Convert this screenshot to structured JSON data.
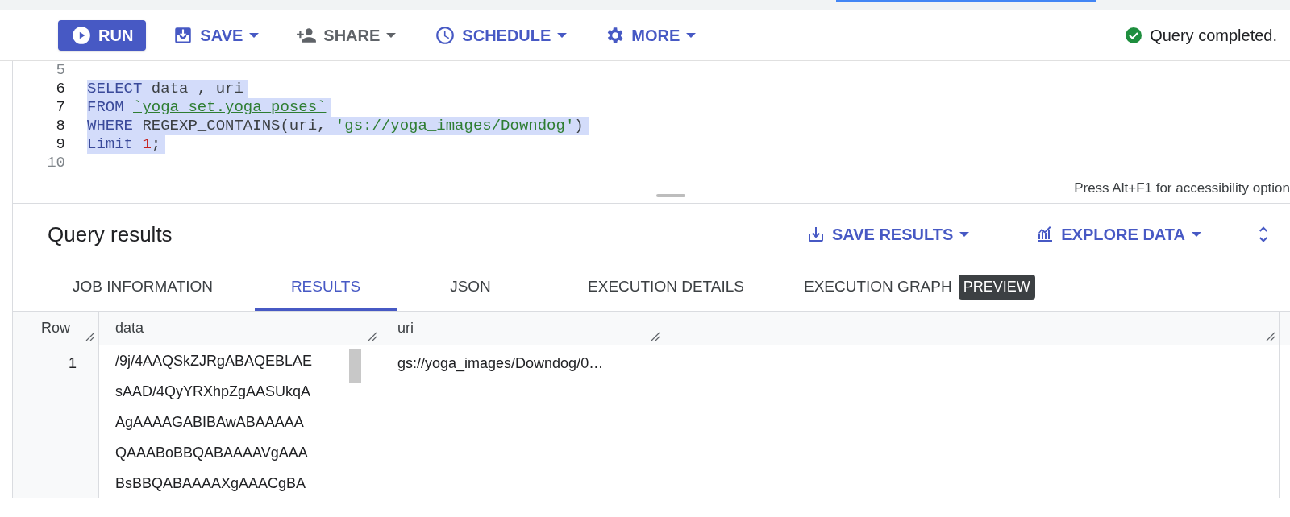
{
  "toolbar": {
    "buttons": [
      {
        "kind": "run",
        "label": "RUN"
      },
      {
        "kind": "save",
        "label": "SAVE",
        "dropdown": true
      },
      {
        "kind": "share",
        "label": "SHARE",
        "dropdown": true
      },
      {
        "kind": "schedule",
        "label": "SCHEDULE",
        "dropdown": true
      },
      {
        "kind": "more",
        "label": "MORE",
        "dropdown": true
      }
    ],
    "status": "Query completed."
  },
  "editor": {
    "lines": [
      {
        "number": "5",
        "selected": false
      },
      {
        "number": "6",
        "selected": true,
        "tokens": [
          {
            "kind": "keyword",
            "text": "SELECT"
          },
          {
            "kind": "plain",
            "text": " data , uri"
          }
        ]
      },
      {
        "number": "7",
        "selected": true,
        "tokens": [
          {
            "kind": "keyword",
            "text": "FROM "
          },
          {
            "kind": "table",
            "text": "`yoga_set.yoga_poses`"
          }
        ]
      },
      {
        "number": "8",
        "selected": true,
        "tokens": [
          {
            "kind": "keyword",
            "text": "WHERE"
          },
          {
            "kind": "plain",
            "text": " REGEXP_CONTAINS(uri, "
          },
          {
            "kind": "string",
            "text": "'gs://yoga_images/Downdog'"
          },
          {
            "kind": "plain",
            "text": ")"
          }
        ]
      },
      {
        "number": "9",
        "selected": true,
        "tokens": [
          {
            "kind": "keyword",
            "text": "Limit "
          },
          {
            "kind": "number",
            "text": "1"
          },
          {
            "kind": "plain",
            "text": ";"
          }
        ]
      },
      {
        "number": "10",
        "selected": false
      }
    ],
    "hint": "Press Alt+F1 for accessibility option"
  },
  "results": {
    "title": "Query results",
    "actions": [
      {
        "kind": "save",
        "label": "SAVE RESULTS"
      },
      {
        "kind": "explore",
        "label": "EXPLORE DATA"
      }
    ],
    "tabs": [
      {
        "label": "JOB INFORMATION",
        "selected": false
      },
      {
        "label": "RESULTS",
        "selected": true
      },
      {
        "label": "JSON",
        "selected": false
      },
      {
        "label": "EXECUTION DETAILS",
        "selected": false
      },
      {
        "label": "EXECUTION GRAPH",
        "selected": false,
        "badge": "PREVIEW"
      }
    ],
    "table": {
      "columns": [
        "Row",
        "data",
        "uri"
      ],
      "rows": [
        {
          "row": "1",
          "data": [
            "/9j/4AAQSkZJRgABAQEBLAE",
            "sAAD/4QyYRXhpZgAASUkqA",
            "AgAAAAGABIBAwABAAAAA",
            "QAAABoBBQABAAAAVgAAA",
            "BsBBQABAAAAXgAAACgBA"
          ],
          "uri": "gs://yoga_images/Downdog/0…"
        }
      ]
    }
  }
}
